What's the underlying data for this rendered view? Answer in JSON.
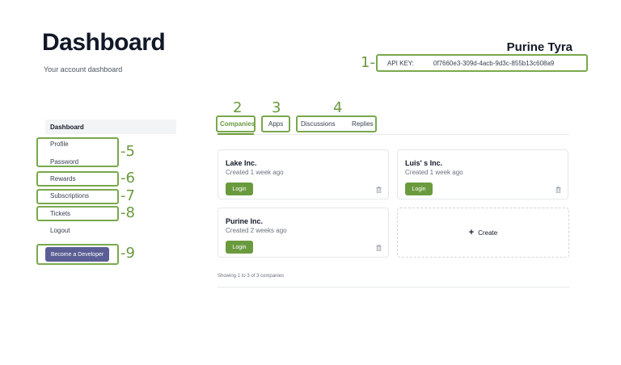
{
  "header": {
    "title": "Dashboard",
    "subtitle": "Your account dashboard",
    "user_name": "Purine Tyra",
    "api_key_label": "API KEY:",
    "api_key_value": "0f7660e3-309d-4acb-9d3c-855b13c608a9"
  },
  "sidebar": {
    "items": [
      {
        "label": "Dashboard"
      },
      {
        "label": "Profile"
      },
      {
        "label": "Password"
      },
      {
        "label": "Rewards"
      },
      {
        "label": "Subscriptions"
      },
      {
        "label": "Tickets"
      },
      {
        "label": "Logout"
      }
    ],
    "developer_button": "Become a Developer"
  },
  "tabs": [
    {
      "label": "Companies"
    },
    {
      "label": "Apps"
    },
    {
      "label": "Discussions"
    },
    {
      "label": "Replies"
    }
  ],
  "companies": [
    {
      "name": "Lake Inc.",
      "created": "Created 1 week ago",
      "login_label": "Login"
    },
    {
      "name": "Luis' s Inc.",
      "created": "Created 1 week ago",
      "login_label": "Login"
    },
    {
      "name": "Purine Inc.",
      "created": "Created 2 weeks ago",
      "login_label": "Login"
    }
  ],
  "create_label": "Create",
  "create_icon": "plus-icon",
  "pagination_text": "Showing 1 to 3 of 3 companies",
  "annotations": {
    "n1": "1",
    "n2": "2",
    "n3": "3",
    "n4": "4",
    "n5": "5",
    "n6": "6",
    "n7": "7",
    "n8": "8",
    "n9": "9"
  },
  "colors": {
    "accent_green": "#6a9a3e",
    "developer_button": "#5b5e94"
  }
}
